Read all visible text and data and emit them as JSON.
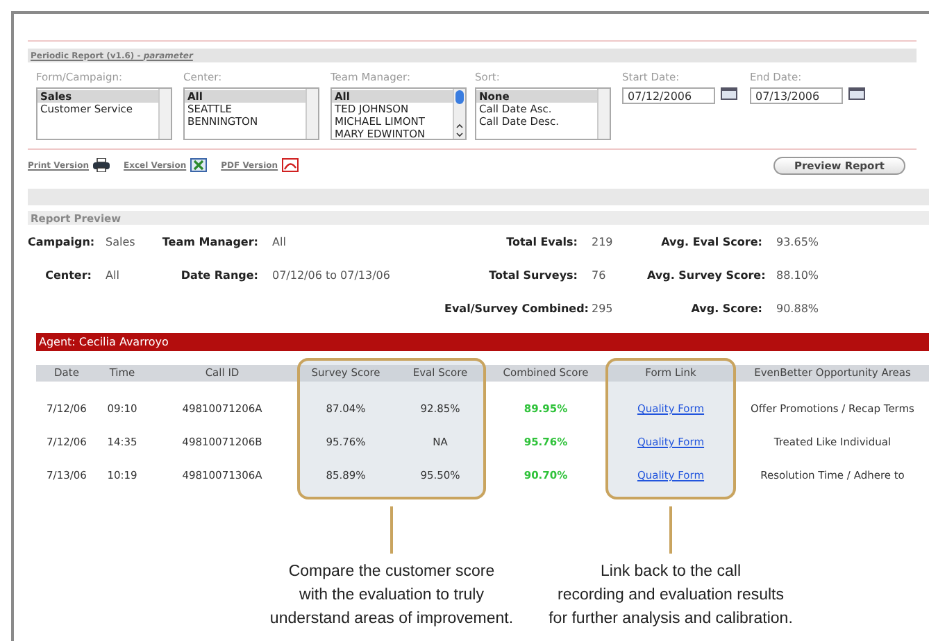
{
  "report_link": "Periodic Report (v1.6) - *parameter*",
  "filters": [
    {
      "label": "Form/Campaign:",
      "kind": "list",
      "options": [
        {
          "text": "Sales",
          "selected": true
        },
        {
          "text": "Customer Service",
          "selected": false
        }
      ]
    },
    {
      "label": "Center:",
      "kind": "list",
      "options": [
        {
          "text": "All",
          "selected": true
        },
        {
          "text": "SEATTLE",
          "selected": false
        },
        {
          "text": "BENNINGTON",
          "selected": false
        }
      ]
    },
    {
      "label": "Team Manager:",
      "kind": "scroll-list",
      "options": [
        {
          "text": "All",
          "selected": true
        },
        {
          "text": "TED JOHNSON",
          "selected": false
        },
        {
          "text": "MICHAEL LIMONT",
          "selected": false
        },
        {
          "text": "MARY EDWINTON",
          "selected": false
        }
      ]
    },
    {
      "label": "Sort:",
      "kind": "list",
      "options": [
        {
          "text": "None",
          "selected": true
        },
        {
          "text": "Call Date Asc.",
          "selected": false
        },
        {
          "text": "Call Date Desc.",
          "selected": false
        }
      ]
    },
    {
      "label": "Start Date:",
      "kind": "date",
      "value": "07/12/2006"
    },
    {
      "label": "End Date:",
      "kind": "date",
      "value": "07/13/2006"
    }
  ],
  "exports": [
    {
      "label": "Print Version",
      "kind": "print"
    },
    {
      "label": "Excel Version",
      "kind": "excel"
    },
    {
      "label": "PDF Version",
      "kind": "pdf"
    }
  ],
  "preview_button": "Preview Report",
  "preview": {
    "title": "Report Preview",
    "filters": [
      {
        "label": "Campaign:",
        "value": "Sales"
      },
      {
        "label": "Team Manager:",
        "value": "All"
      },
      {
        "label": "Center:",
        "value": "All"
      },
      {
        "label": "Date Range:",
        "value": "07/12/06 to 07/13/06"
      }
    ],
    "totals": [
      {
        "label": "Total Evals:",
        "value": "219"
      },
      {
        "label": "Avg. Eval Score:",
        "value": "93.65%"
      },
      {
        "label": "Total Surveys:",
        "value": "76"
      },
      {
        "label": "Avg. Survey Score:",
        "value": "88.10%"
      },
      {
        "label": "Eval/Survey Combined:",
        "value": "295"
      },
      {
        "label": "Avg. Score:",
        "value": "90.88%"
      }
    ]
  },
  "agent": "Agent: Cecilia Avarroyo",
  "table": {
    "columns": [
      {
        "label": "Date",
        "kind": "text",
        "highlighted": false
      },
      {
        "label": "Time",
        "kind": "text",
        "highlighted": false
      },
      {
        "label": "Call ID",
        "kind": "text",
        "highlighted": false
      },
      {
        "label": "Survey Score",
        "kind": "text",
        "highlighted": true
      },
      {
        "label": "Eval Score",
        "kind": "text",
        "highlighted": true
      },
      {
        "label": "Combined Score",
        "kind": "score",
        "highlighted": false
      },
      {
        "label": "Form Link",
        "kind": "link",
        "highlighted": true
      },
      {
        "label": "EvenBetter Opportunity Areas",
        "kind": "text",
        "highlighted": false
      }
    ],
    "rows": [
      [
        "7/12/06",
        "09:10",
        "49810071206A",
        "87.04%",
        "92.85%",
        "89.95%",
        "Quality Form",
        "Offer Promotions / Recap Terms"
      ],
      [
        "7/12/06",
        "14:35",
        "49810071206B",
        "95.76%",
        "NA",
        "95.76%",
        "Quality Form",
        "Treated Like Individual"
      ],
      [
        "7/13/06",
        "10:19",
        "49810071306A",
        "85.89%",
        "95.50%",
        "90.70%",
        "Quality Form",
        "Resolution Time / Adhere to"
      ]
    ]
  },
  "callouts": [
    {
      "lines": [
        "Compare the customer score",
        "with the evaluation to truly",
        "understand areas of improvement."
      ]
    },
    {
      "lines": [
        "Link back to the call",
        "recording and evaluation results",
        "for further analysis and calibration."
      ]
    }
  ]
}
